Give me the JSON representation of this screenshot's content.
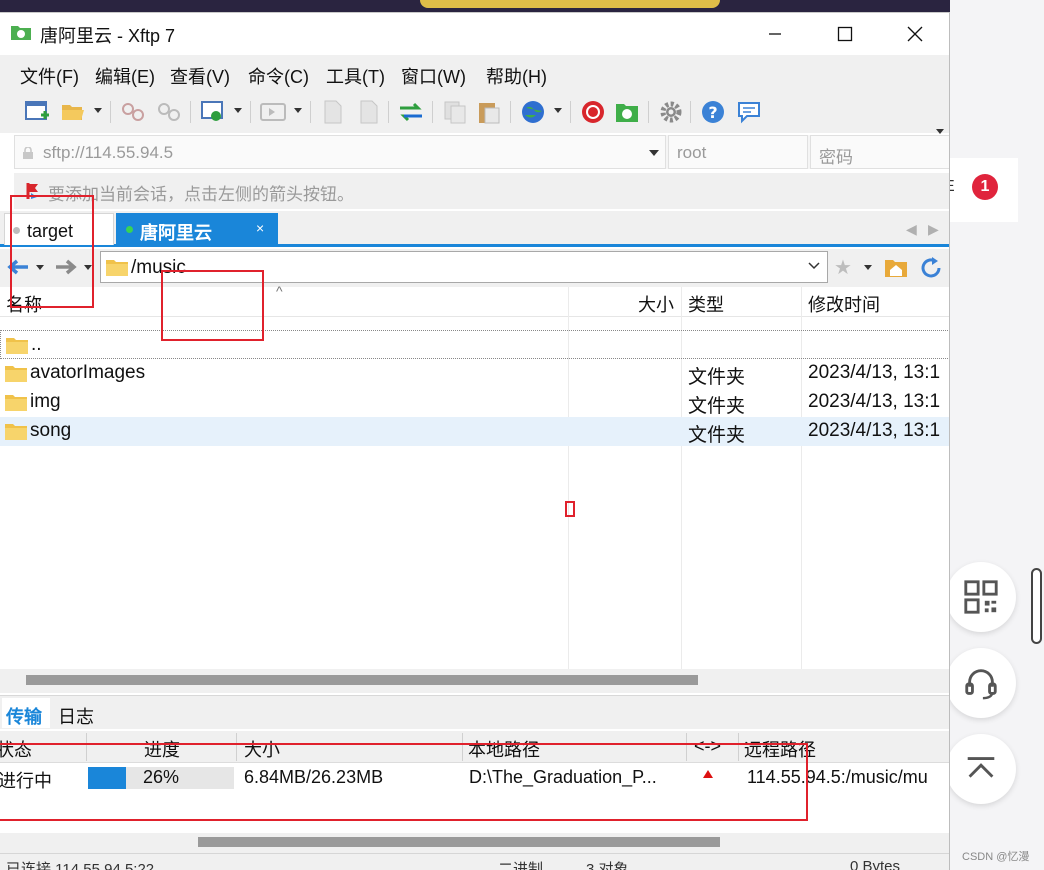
{
  "window": {
    "title": "唐阿里云 - Xftp 7"
  },
  "menu": [
    "文件(F)",
    "编辑(E)",
    "查看(V)",
    "命令(C)",
    "工具(T)",
    "窗口(W)",
    "帮助(H)"
  ],
  "address": {
    "host_placeholder": "sftp://114.55.94.5",
    "user_placeholder": "root",
    "password_placeholder": "密码"
  },
  "hint": "要添加当前会话，点击左侧的箭头按钮。",
  "tabs": [
    {
      "label": "target",
      "active": false
    },
    {
      "label": "唐阿里云",
      "active": true,
      "close": "×"
    }
  ],
  "path": "/music",
  "columns": {
    "name": "名称",
    "size": "大小",
    "type": "类型",
    "modified": "修改时间",
    "sort_indicator": "^"
  },
  "files": [
    {
      "name": "..",
      "type": "",
      "modified": ""
    },
    {
      "name": "avatorImages",
      "type": "文件夹",
      "modified": "2023/4/13, 13:1"
    },
    {
      "name": "img",
      "type": "文件夹",
      "modified": "2023/4/13, 13:1"
    },
    {
      "name": "song",
      "type": "文件夹",
      "modified": "2023/4/13, 13:1"
    }
  ],
  "bottom_tabs": {
    "transfer": "传输",
    "log": "日志"
  },
  "transfer_columns": {
    "status": "状态",
    "progress": "进度",
    "size": "大小",
    "local": "本地路径",
    "direction": "<->",
    "remote": "远程路径"
  },
  "transfers": [
    {
      "status": "进行中",
      "progress_percent": 26,
      "progress_label": "26%",
      "size": "6.84MB/26.23MB",
      "local": "D:\\The_Graduation_P...",
      "remote": "114.55.94.5:/music/mu"
    }
  ],
  "status": {
    "connected": "已连接 114.55.94.5:22",
    "mode": "二进制",
    "objects": "3 对象",
    "bytes": "0 Bytes"
  },
  "side": {
    "card_suffix": "E",
    "badge": "1",
    "watermark": "CSDN @忆漫"
  },
  "colors": {
    "accent": "#1a86d9",
    "annotation": "#e0212c",
    "badge": "#e0243c"
  }
}
